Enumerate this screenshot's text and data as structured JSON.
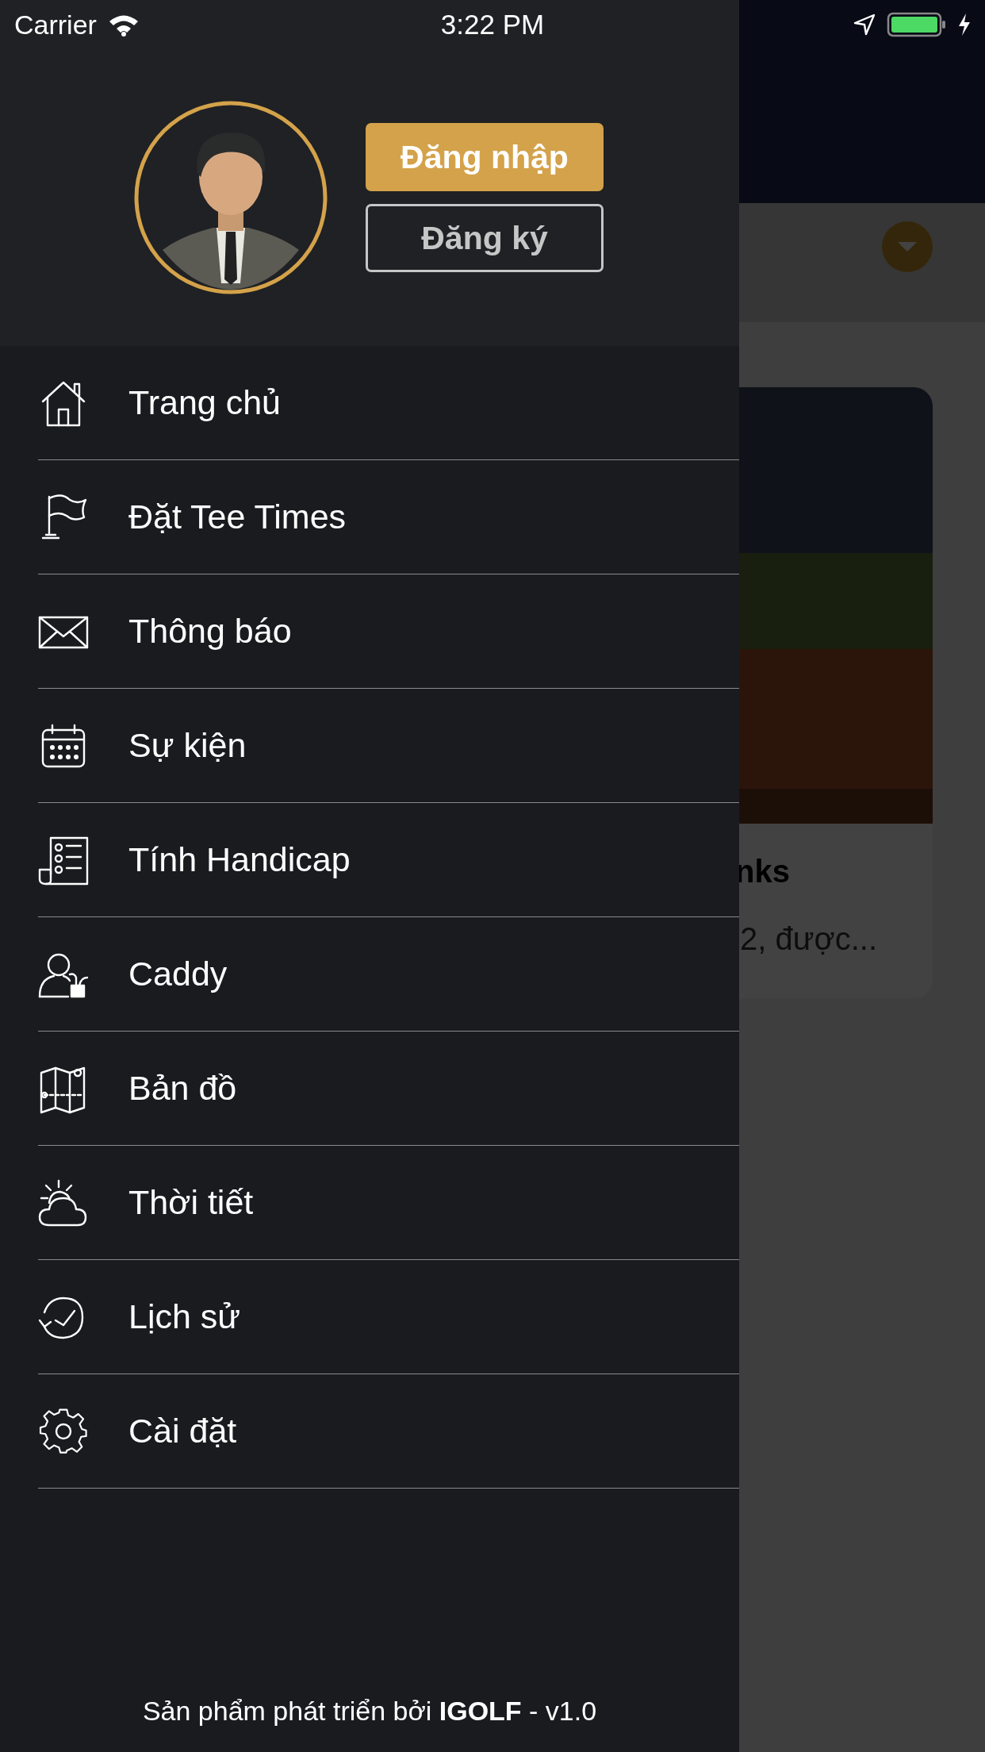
{
  "status_bar": {
    "carrier": "Carrier",
    "time": "3:22 PM"
  },
  "background": {
    "card_title": "nks",
    "card_text": "2, được..."
  },
  "drawer": {
    "buttons": [
      {
        "label": "Đăng nhập",
        "kind": "primary"
      },
      {
        "label": "Đăng ký",
        "kind": "outline"
      }
    ],
    "menu": [
      {
        "label": "Trang chủ"
      },
      {
        "label": "Đặt Tee Times"
      },
      {
        "label": "Thông báo"
      },
      {
        "label": "Sự kiện"
      },
      {
        "label": "Tính Handicap"
      },
      {
        "label": "Caddy"
      },
      {
        "label": "Bản đồ"
      },
      {
        "label": "Thời tiết"
      },
      {
        "label": "Lịch sử"
      },
      {
        "label": "Cài đặt"
      }
    ],
    "footer": "Sản phẩm phát triển bởi **IGOLF** - v1.0"
  }
}
